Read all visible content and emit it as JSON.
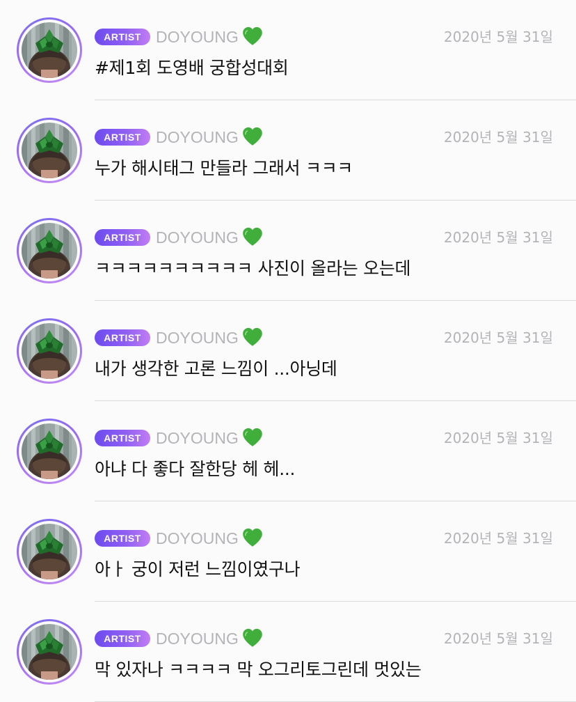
{
  "colors": {
    "background": "#fbfbfc",
    "badge_start": "#6d4bf0",
    "badge_end": "#c17df4",
    "muted_text": "#b3b3b8",
    "heart": "#3fae3a",
    "avatar_ring": "#a06cf0"
  },
  "messages": [
    {
      "badge": "ARTIST",
      "name": "DOYOUNG",
      "icon": "green-heart-icon",
      "date": "2020년 5월 31일",
      "text": "#제1회 도영배 궁합성대회"
    },
    {
      "badge": "ARTIST",
      "name": "DOYOUNG",
      "icon": "green-heart-icon",
      "date": "2020년 5월 31일",
      "text": "누가 해시태그 만들라 그래서 ㅋㅋㅋ"
    },
    {
      "badge": "ARTIST",
      "name": "DOYOUNG",
      "icon": "green-heart-icon",
      "date": "2020년 5월 31일",
      "text": "ㅋㅋㅋㅋㅋㅋㅋㅋㅋㅋ 사진이 올라는 오는데"
    },
    {
      "badge": "ARTIST",
      "name": "DOYOUNG",
      "icon": "green-heart-icon",
      "date": "2020년 5월 31일",
      "text": "내가 생각한 고론 느낌이 ...아닝데"
    },
    {
      "badge": "ARTIST",
      "name": "DOYOUNG",
      "icon": "green-heart-icon",
      "date": "2020년 5월 31일",
      "text": "아냐 다 좋다  잘한당  헤 헤..."
    },
    {
      "badge": "ARTIST",
      "name": "DOYOUNG",
      "icon": "green-heart-icon",
      "date": "2020년 5월 31일",
      "text": "아ㅏ 궁이 저런 느낌이였구나"
    },
    {
      "badge": "ARTIST",
      "name": "DOYOUNG",
      "icon": "green-heart-icon",
      "date": "2020년 5월 31일",
      "text": "막 있자나 ㅋㅋㅋㅋ 막 오그리토그린데 멋있는"
    }
  ]
}
